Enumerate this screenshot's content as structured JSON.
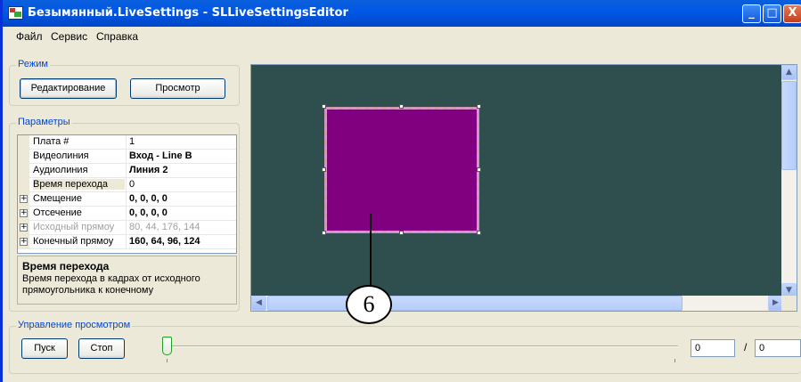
{
  "window": {
    "title": "Безымянный.LiveSettings - SLLiveSettingsEditor",
    "controls": {
      "minimize": "_",
      "maximize": "□",
      "close": "X"
    }
  },
  "menu": {
    "items": [
      "Файл",
      "Сервис",
      "Справка"
    ]
  },
  "mode_group": {
    "legend": "Режим",
    "edit_button": "Редактирование",
    "view_button": "Просмотр"
  },
  "params_group": {
    "legend": "Параметры",
    "rows": [
      {
        "name": "Плата #",
        "value": "1",
        "bold": false,
        "expandable": false,
        "disabled": false
      },
      {
        "name": "Видеолиния",
        "value": "Вход - Line B",
        "bold": true,
        "expandable": false,
        "disabled": false
      },
      {
        "name": "Аудиолиния",
        "value": "Линия 2",
        "bold": true,
        "expandable": false,
        "disabled": false
      },
      {
        "name": "Время перехода",
        "value": "0",
        "bold": false,
        "expandable": false,
        "disabled": false
      },
      {
        "name": "Смещение",
        "value": "0, 0, 0, 0",
        "bold": true,
        "expandable": true,
        "disabled": false
      },
      {
        "name": "Отсечение",
        "value": "0, 0, 0, 0",
        "bold": true,
        "expandable": true,
        "disabled": false
      },
      {
        "name": "Исходный прямоу",
        "value": "80, 44, 176, 144",
        "bold": false,
        "expandable": true,
        "disabled": true
      },
      {
        "name": "Конечный прямоу",
        "value": "160, 64, 96, 124",
        "bold": true,
        "expandable": true,
        "disabled": false
      }
    ],
    "description": {
      "title": "Время перехода",
      "text": "Время перехода в кадрах от исходного прямоугольника к конечному"
    }
  },
  "preview": {
    "background_color": "#2e4f4d",
    "rect_color": "#800080",
    "callout_label": "6"
  },
  "playback_group": {
    "legend": "Управление просмотром",
    "play_button": "Пуск",
    "stop_button": "Стоп",
    "current_frame": "0",
    "separator": "/",
    "total_frames": "0",
    "slider_position": 0
  }
}
